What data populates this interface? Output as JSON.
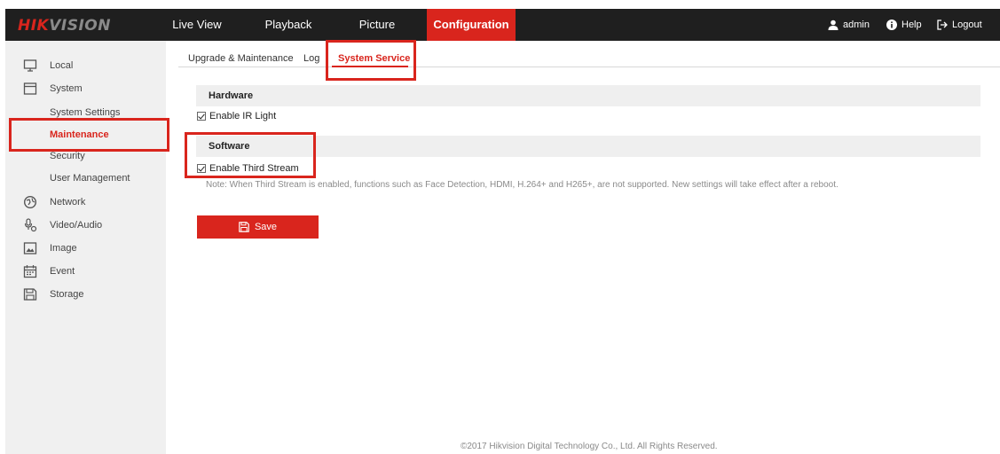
{
  "brand": {
    "part1": "HIK",
    "part2": "VISION"
  },
  "nav": {
    "live_view": "Live View",
    "playback": "Playback",
    "picture": "Picture",
    "configuration": "Configuration"
  },
  "user": {
    "admin": "admin",
    "help": "Help",
    "logout": "Logout"
  },
  "sidebar": {
    "local": "Local",
    "system": "System",
    "system_settings": "System Settings",
    "maintenance": "Maintenance",
    "security": "Security",
    "user_management": "User Management",
    "network": "Network",
    "video_audio": "Video/Audio",
    "image": "Image",
    "event": "Event",
    "storage": "Storage"
  },
  "tabs": {
    "upgrade": "Upgrade & Maintenance",
    "log": "Log",
    "system_service": "System Service"
  },
  "hardware": {
    "title": "Hardware",
    "enable_ir_light": "Enable IR Light",
    "enable_ir_light_checked": true
  },
  "software": {
    "title": "Software",
    "enable_third_stream": "Enable Third Stream",
    "enable_third_stream_checked": true,
    "note": "Note: When Third Stream is enabled, functions such as Face Detection, HDMI, H.264+ and H265+, are not supported. New settings will take effect after a reboot."
  },
  "save_label": "Save",
  "footer": "©2017 Hikvision Digital Technology Co., Ltd. All Rights Reserved.",
  "colors": {
    "accent": "#d9251d",
    "topbar": "#1f1f1f",
    "sidebar": "#f0f0f0",
    "section": "#efefef"
  },
  "icons": [
    "person-icon",
    "help-icon",
    "logout-icon",
    "monitor-icon",
    "system-icon",
    "network-icon",
    "video-audio-icon",
    "image-icon",
    "event-icon",
    "storage-icon",
    "save-icon"
  ]
}
